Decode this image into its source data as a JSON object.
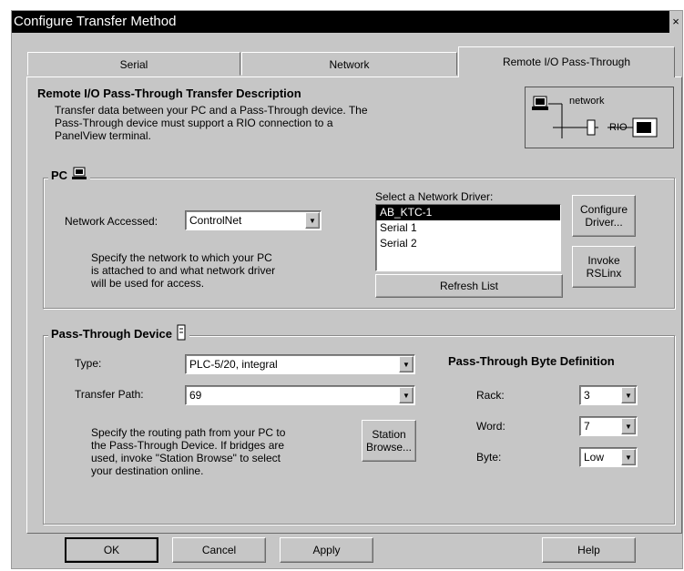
{
  "window": {
    "title": "Configure Transfer Method",
    "close_glyph": "×"
  },
  "tabs": [
    {
      "label": "Serial"
    },
    {
      "label": "Network"
    },
    {
      "label": "Remote I/O Pass-Through"
    }
  ],
  "description": {
    "heading": "Remote I/O Pass-Through Transfer Description",
    "line1": "Transfer data between your PC and a Pass-Through device.  The",
    "line2": "Pass-Through device must support a RIO connection to a",
    "line3": "PanelView terminal."
  },
  "diagram": {
    "network_label": "network",
    "rio_label": "RIO"
  },
  "pc_group": {
    "title": "PC",
    "network_accessed_label": "Network Accessed:",
    "network_accessed_value": "ControlNet",
    "help_line1": "Specify the network to which your PC",
    "help_line2": "is attached to and what network driver",
    "help_line3": "will be used for access.",
    "driver_label": "Select a Network Driver:",
    "drivers": [
      "AB_KTC-1",
      "Serial 1",
      "Serial 2"
    ],
    "configure_line1": "Configure",
    "configure_line2": "Driver...",
    "invoke_line1": "Invoke",
    "invoke_line2": "RSLinx",
    "refresh_label": "Refresh List"
  },
  "pt_group": {
    "title": "Pass-Through Device",
    "type_label": "Type:",
    "type_value": "PLC-5/20, integral",
    "path_label": "Transfer Path:",
    "path_value": "69",
    "help_line1": "Specify the routing path from your PC to",
    "help_line2": "the Pass-Through Device.  If bridges are",
    "help_line3": "used, invoke \"Station Browse\" to select",
    "help_line4": "your destination online.",
    "station_line1": "Station",
    "station_line2": "Browse...",
    "byte_def_title": "Pass-Through Byte Definition",
    "rack_label": "Rack:",
    "rack_value": "3",
    "word_label": "Word:",
    "word_value": "7",
    "byte_label": "Byte:",
    "byte_value": "Low"
  },
  "footer": {
    "ok": "OK",
    "cancel": "Cancel",
    "apply": "Apply",
    "help": "Help"
  },
  "dropdown_glyph": "▼"
}
